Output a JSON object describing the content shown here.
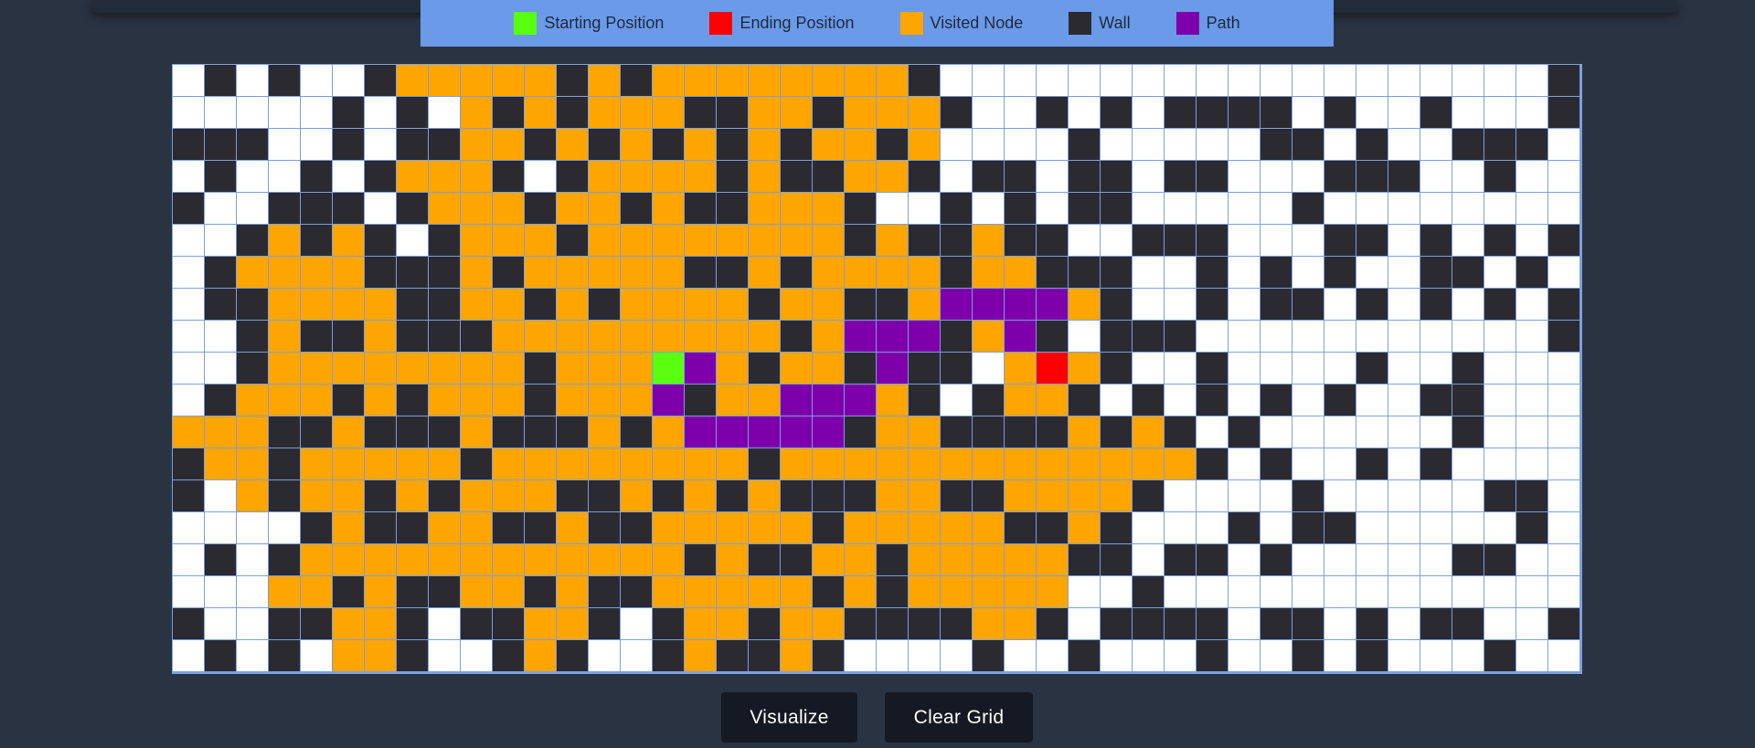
{
  "legend": [
    {
      "label": "Starting Position",
      "color": "#5aff10"
    },
    {
      "label": "Ending Position",
      "color": "#ff0000"
    },
    {
      "label": "Visited Node",
      "color": "#ffa500"
    },
    {
      "label": "Wall",
      "color": "#2b2a30"
    },
    {
      "label": "Path",
      "color": "#7d00aa"
    }
  ],
  "grid": {
    "columns": 44,
    "row_count": 19,
    "legend_codes": {
      ".": "empty",
      "W": "wall",
      "V": "visited",
      "P": "path",
      "S": "start",
      "E": "end"
    },
    "rows": [
      ".W.W..WVVVVVWVWVVVVVVVVW...................W.",
      ".....W.W.VWVWVVVWWVVWVVVW..W.W.WWWW.W..W...W..",
      "WWW..W.WWVVWVWVWVWVWVVWV....W.....WW.W..WWW.W",
      ".W..W.WVVVW.WVVVVWVWWVVW.WW.WW.WW...WWW..W...",
      "W..WWW.WVVVWVVWVWWVVVW..W.W.WW.....W........",
      "..WVWVW.WVVVWVVVVVVVVWVWWVWW..WWW...WW.W.W.W",
      ".WVVVVWWWVWVVVVVWWVWVVVVWVVWWW..W.W.W..WW.W..",
      ".WWVVVVWWVVWVWVVVVWVVWWVPPPPVW..W.WW.W.W.W.WW.",
      "..WVWWVWWWVVVVVVVVVWVPPPWVPW.WWW...........W.W..",
      "..WVVVVVVVVWVVVSPVWVVWPWW.VEVW..W....W..W....W",
      ".WVVVWVWVVVWVVVPWVVPPPVW.WVVW.W.W.W.W..WW....",
      "VVVWWVWWWVWWWVWVPPPPPWVVWWWWVWVW.W......W....",
      "WVVWVVVVVWVVVVVVVVWVVVVVVVVVVVVVW.W..W.W...",
      "W.VWVVWVWVVVWWVWVWVWWWVVWWVVVVW....W.....WW.WW",
      "....WVWWVVWWVWWVVVVVWVVVVVWWVW...W.WW.....W...",
      ".W.WVVVVVVVVVVVVWVWWVVWVVVVVWW.WW.W.....WW..W.",
      "...VVWVWWVVWVWWVVVVVWVWVVVVV..W...............WW.W",
      "W..WWVVW.WWVVW.WVVWVVWWWWVVW.WWWW.WW.W.WW..W..",
      ".W.W.VVW..WVW..WVWWVW....W..W...W..W.W...W...."
    ]
  },
  "buttons": {
    "visualize_label": "Visualize",
    "clear_label": "Clear Grid"
  }
}
